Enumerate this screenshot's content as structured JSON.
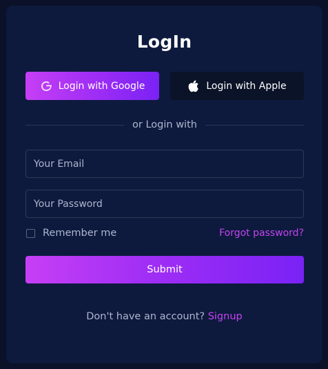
{
  "title": "LogIn",
  "social": {
    "google_label": "Login with Google",
    "apple_label": "Login with Apple"
  },
  "divider_text": "or Login with",
  "form": {
    "email_placeholder": "Your Email",
    "password_placeholder": "Your Password",
    "remember_label": "Remember me",
    "forgot_label": "Forgot password?",
    "submit_label": "Submit"
  },
  "footer": {
    "prompt": "Don't have an account?",
    "signup_label": "Signup"
  },
  "colors": {
    "page_bg": "#0a1128",
    "card_bg": "#0d1a3d",
    "accent": "#c443f0",
    "gradient_start": "#c63ff5",
    "gradient_end": "#7a22f5",
    "apple_button_bg": "#0b1328"
  },
  "icons": {
    "google": "google-icon",
    "apple": "apple-icon"
  }
}
